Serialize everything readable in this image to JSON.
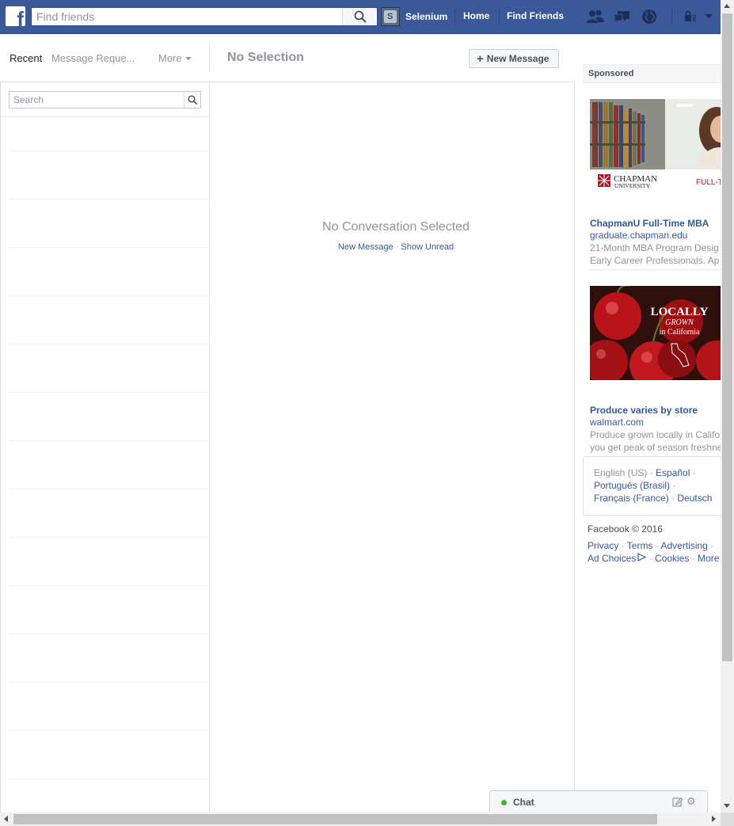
{
  "topbar": {
    "logo_letter": "f",
    "search_placeholder": "Find friends",
    "profile_name": "Selenium",
    "nav": {
      "home": "Home",
      "find_friends": "Find Friends"
    },
    "icons": [
      "friend-requests-icon",
      "messages-icon",
      "notifications-globe-icon",
      "privacy-shortcuts-icon",
      "account-menu-caret-icon"
    ]
  },
  "messages": {
    "tabs": {
      "recent": "Recent",
      "requests": "Message Reque...",
      "more": "More"
    },
    "title": "No Selection",
    "new_message_label": "New Message",
    "search_placeholder": "Search",
    "empty_title": "No Conversation Selected",
    "empty_links": {
      "new_message": "New Message",
      "separator": "·",
      "show_unread": "Show Unread"
    }
  },
  "sponsored": {
    "header": "Sponsored",
    "ads": [
      {
        "image_text": {
          "logo_line1": "CHAPMAN",
          "logo_line2": "UNIVERSITY",
          "side": "FULL-T"
        },
        "title": "ChapmanU Full-Time MBA",
        "url": "graduate.chapman.edu",
        "desc_line1": "21-Month MBA Program Desig",
        "desc_line2": "Early Career Professionals. Ap"
      },
      {
        "image_text": {
          "line1": "LOCALLY",
          "line2": "GROWN",
          "line3": "in California"
        },
        "title": "Produce varies by store",
        "url": "walmart.com",
        "desc_line1": "Produce grown locally in Califo",
        "desc_line2": "you get peak of season freshne"
      }
    ]
  },
  "languages": {
    "current": "English (US)",
    "options": [
      "Español",
      "Português (Brasil)",
      "Français (France)",
      "Deutsch"
    ]
  },
  "footer": {
    "copyright": "Facebook © 2016",
    "links": [
      "Privacy",
      "Terms",
      "Advertising",
      "Ad Choices",
      "Cookies",
      "More"
    ]
  },
  "chat": {
    "label": "Chat"
  },
  "colors": {
    "brand": "#3b5998",
    "link": "#365899",
    "muted": "#90949c",
    "online": "#42b72a"
  }
}
